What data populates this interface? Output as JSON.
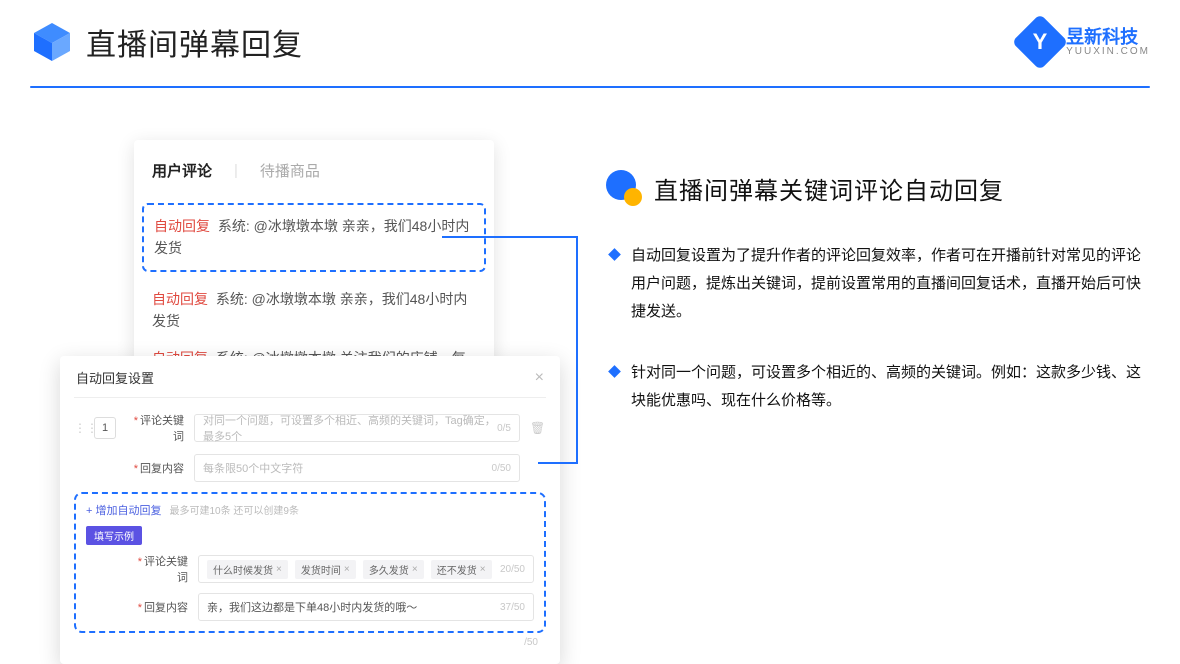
{
  "header": {
    "title": "直播间弹幕回复",
    "brand_name": "昱新科技",
    "brand_sub": "YUUXIN.COM"
  },
  "right": {
    "section_title": "直播间弹幕关键词评论自动回复",
    "bullets": [
      "自动回复设置为了提升作者的评论回复效率，作者可在开播前针对常见的评论用户问题，提炼出关键词，提前设置常用的直播间回复话术，直播开始后可快捷发送。",
      "针对同一个问题，可设置多个相近的、高频的关键词。例如：这款多少钱、这块能优惠吗、现在什么价格等。"
    ]
  },
  "comments_card": {
    "tab_active": "用户评论",
    "tab_inactive": "待播商品",
    "autoreply_tag": "自动回复",
    "sys_label": "系统:",
    "line1": "@冰墩墩本墩 亲亲，我们48小时内发货",
    "line2": "@冰墩墩本墩 亲亲，我们48小时内发货",
    "line3": "@冰墩墩本墩 关注我们的店铺，每日都有热门推荐呦～"
  },
  "settings_card": {
    "title": "自动回复设置",
    "index": "1",
    "label_keyword": "评论关键词",
    "placeholder_keyword": "对同一个问题，可设置多个相近、高频的关键词，Tag确定，最多5个",
    "counter_keyword": "0/5",
    "label_reply": "回复内容",
    "placeholder_reply": "每条限50个中文字符",
    "counter_reply": "0/50",
    "add_link": "+ 增加自动回复",
    "add_hint": "最多可建10条 还可以创建9条",
    "example_badge": "填写示例",
    "ex_label_keyword": "评论关键词",
    "ex_tags": [
      "什么时候发货",
      "发货时间",
      "多久发货",
      "还不发货"
    ],
    "ex_counter_keyword": "20/50",
    "ex_label_reply": "回复内容",
    "ex_reply_value": "亲，我们这边都是下单48小时内发货的哦～",
    "ex_counter_reply": "37/50",
    "outer_counter": "/50"
  }
}
